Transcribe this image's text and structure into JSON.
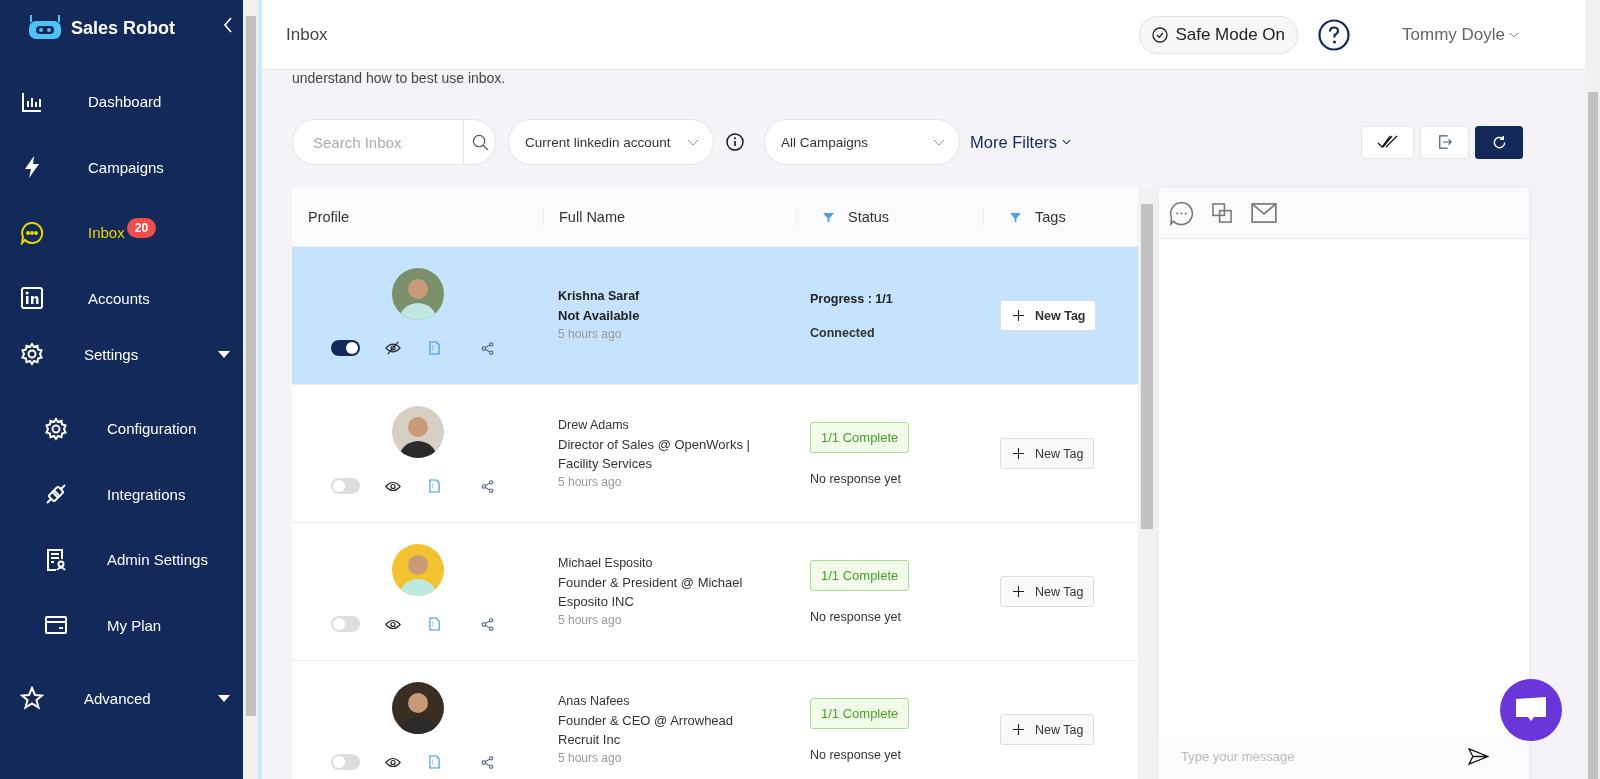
{
  "sidebar": {
    "brand": "Sales Robot",
    "items": [
      {
        "label": "Dashboard",
        "selected": false
      },
      {
        "label": "Campaigns",
        "selected": false
      },
      {
        "label": "Inbox",
        "badge": "20",
        "selected": true
      },
      {
        "label": "Accounts",
        "selected": false
      },
      {
        "label": "Settings",
        "selected": false,
        "has_submenu": true,
        "children": [
          {
            "label": "Configuration"
          },
          {
            "label": "Integrations"
          },
          {
            "label": "Admin Settings"
          },
          {
            "label": "My Plan"
          }
        ]
      },
      {
        "label": "Advanced",
        "selected": false,
        "has_submenu": true
      }
    ]
  },
  "header": {
    "title": "Inbox",
    "safe_mode": "Safe Mode On",
    "user": "Tommy Doyle"
  },
  "intro": "understand how to best use inbox.",
  "filters": {
    "search_placeholder": "Search Inbox",
    "account": "Current linkedin account",
    "campaign": "All Campaigns",
    "more": "More Filters"
  },
  "table": {
    "columns": [
      {
        "label": "Profile",
        "filter": false
      },
      {
        "label": "Full Name",
        "filter": false
      },
      {
        "label": "Status",
        "filter": true
      },
      {
        "label": "Tags",
        "filter": true
      }
    ],
    "rows": [
      {
        "name": "Krishna Saraf",
        "headline": "Not Available",
        "time": "5 hours ago",
        "selected": true,
        "unread": true,
        "on": true,
        "visible": false,
        "status": {
          "kind": "progress",
          "text": "Progress : 1/1"
        },
        "connection": "Connected",
        "tag_button": "New Tag"
      },
      {
        "name": "Drew Adams",
        "headline": "Director of Sales @ OpenWorks | Facility Services",
        "time": "5 hours ago",
        "selected": false,
        "unread": false,
        "on": false,
        "visible": true,
        "status": {
          "kind": "badge",
          "text": "1/1 Complete"
        },
        "connection": "No response yet",
        "tag_button": "New Tag"
      },
      {
        "name": "Michael Esposito",
        "headline": "Founder & President @ Michael Esposito INC",
        "time": "5 hours ago",
        "selected": false,
        "unread": false,
        "on": false,
        "visible": true,
        "status": {
          "kind": "badge",
          "text": "1/1 Complete"
        },
        "connection": "No response yet",
        "tag_button": "New Tag"
      },
      {
        "name": "Anas Nafees",
        "headline": "Founder & CEO @ Arrowhead Recruit Inc",
        "time": "5 hours ago",
        "selected": false,
        "unread": false,
        "on": false,
        "visible": true,
        "status": {
          "kind": "badge",
          "text": "1/1 Complete"
        },
        "connection": "No response yet",
        "tag_button": "New Tag"
      }
    ]
  },
  "chat": {
    "placeholder": "Type your message"
  }
}
